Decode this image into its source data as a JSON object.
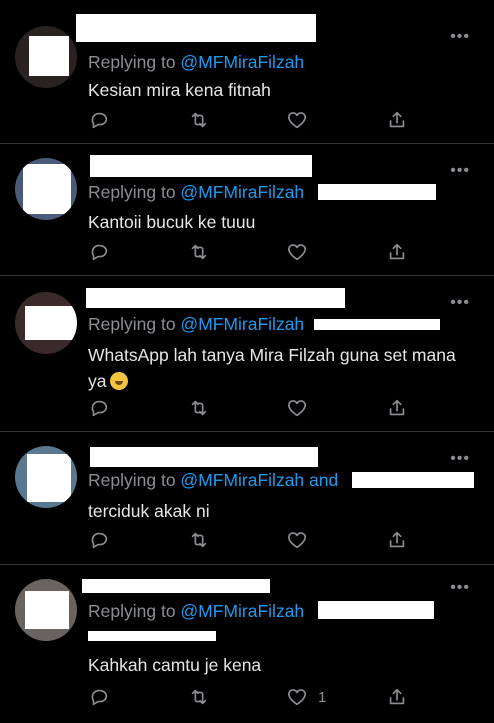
{
  "icons": {
    "reply": "reply-icon",
    "retweet": "retweet-icon",
    "like": "heart-icon",
    "share": "share-icon",
    "more": "more-icon"
  },
  "colors": {
    "background": "#000000",
    "handle": "#1d9bf0",
    "muted": "#8b8f93",
    "text": "#e6e6e6"
  },
  "tweets": [
    {
      "replying_prefix": "Replying to ",
      "handle": "@MFMiraFilzah",
      "handle_suffix": "",
      "text": "Kesian mira kena fitnah",
      "like_count": ""
    },
    {
      "replying_prefix": "Replying to ",
      "handle": "@MFMiraFilzah",
      "handle_suffix": "",
      "text": "Kantoii bucuk ke tuuu",
      "like_count": ""
    },
    {
      "replying_prefix": "Replying to ",
      "handle": "@MFMiraFilzah",
      "handle_suffix": "",
      "text_line1": "WhatsApp lah tanya Mira Filzah guna set mana",
      "text_line2": "ya",
      "like_count": ""
    },
    {
      "replying_prefix": "Replying to ",
      "handle": "@MFMiraFilzah",
      "handle_suffix": " and",
      "text": "terciduk akak ni",
      "like_count": ""
    },
    {
      "replying_prefix": "Replying to ",
      "handle": "@MFMiraFilzah",
      "handle_suffix": "",
      "text": "Kahkah camtu je kena",
      "like_count": "1"
    }
  ]
}
